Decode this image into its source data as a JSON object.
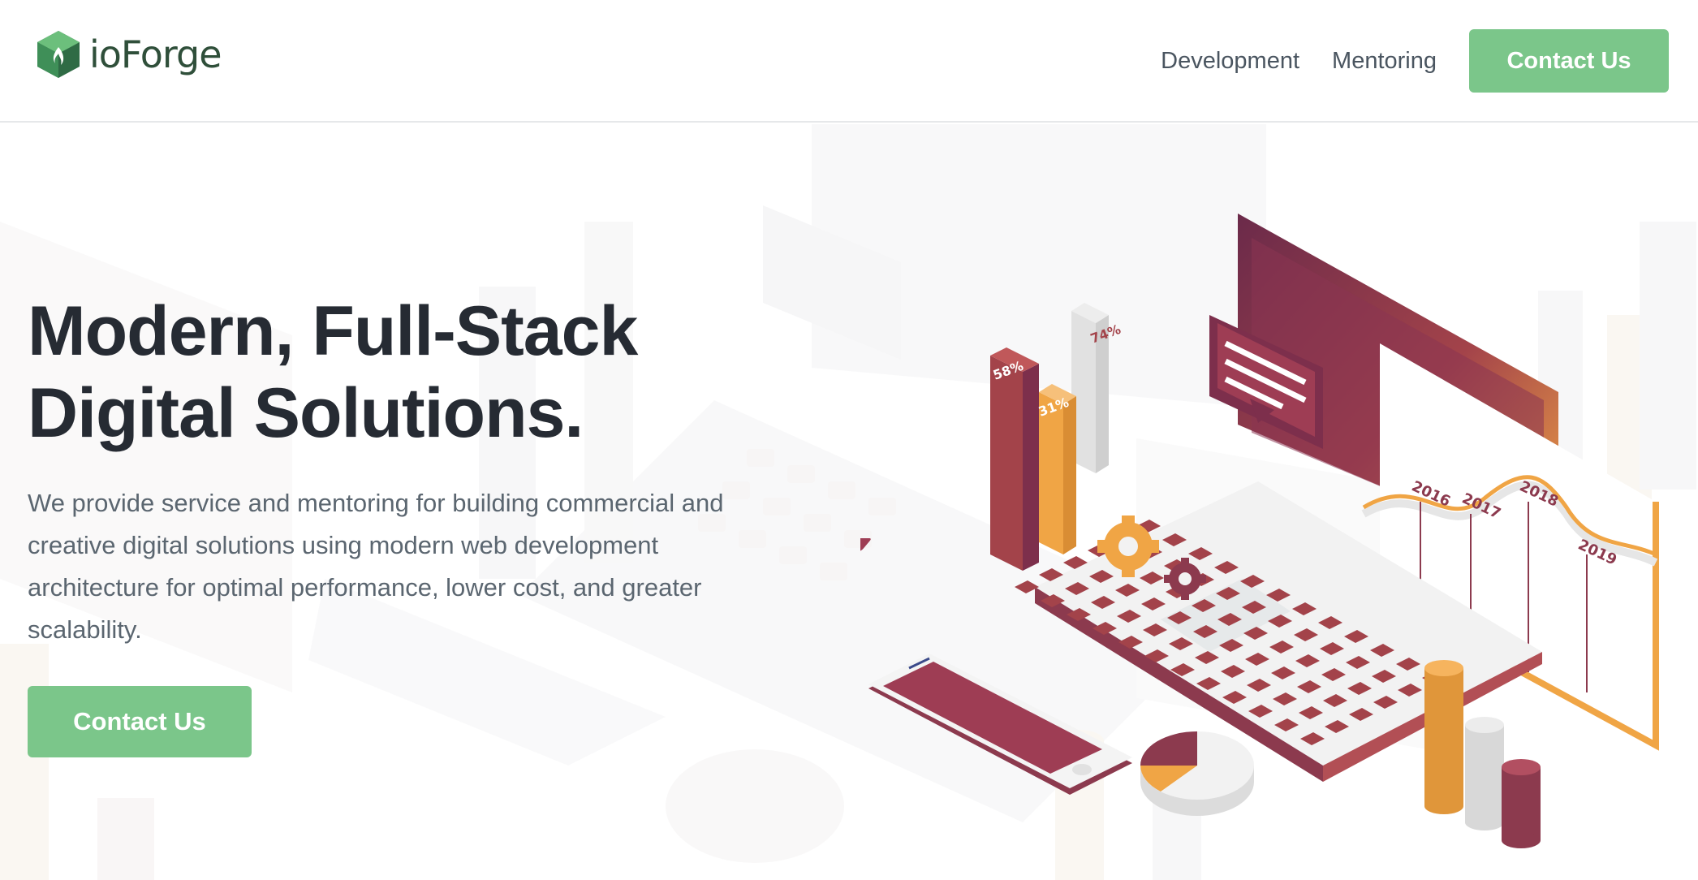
{
  "header": {
    "logo_text": "ioForge",
    "nav": [
      {
        "label": "Development"
      },
      {
        "label": "Mentoring"
      }
    ],
    "cta_label": "Contact Us"
  },
  "hero": {
    "title_line1": "Modern, Full-Stack",
    "title_line2": "Digital Solutions.",
    "description": "We provide service and mentoring for building commercial and creative digital solutions using modern web development architecture for optimal performance, lower cost, and greater scalability.",
    "cta_label": "Contact Us"
  },
  "illustration": {
    "bar_labels": [
      "58%",
      "31%",
      "74%"
    ],
    "year_labels": [
      "2016",
      "2017",
      "2018",
      "2019"
    ]
  },
  "colors": {
    "accent_green": "#7bc68a",
    "logo_green": "#2f6b45",
    "heading": "#262b33",
    "body_text": "#5b6670",
    "maroon": "#8c3a4e",
    "orange": "#f0a545",
    "gray": "#dcdcdc"
  }
}
